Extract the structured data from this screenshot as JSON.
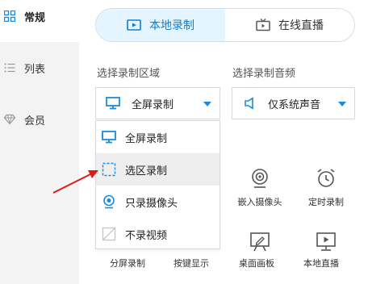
{
  "colors": {
    "accent": "#1a8be0",
    "tab_active_bg": "#e5f5ff",
    "arrow": "#e0191b"
  },
  "sidebar": {
    "items": [
      {
        "label": "常规",
        "icon": "grid-icon",
        "active": true
      },
      {
        "label": "列表",
        "icon": "list-icon",
        "active": false
      },
      {
        "label": "会员",
        "icon": "diamond-icon",
        "active": false
      }
    ]
  },
  "tabs": [
    {
      "label": "本地录制",
      "icon": "video-record-icon",
      "active": true
    },
    {
      "label": "在线直播",
      "icon": "tv-icon",
      "active": false
    }
  ],
  "record_area": {
    "label": "选择录制区域",
    "selected": "全屏录制",
    "options": [
      {
        "label": "全屏录制",
        "icon": "monitor-icon"
      },
      {
        "label": "选区录制",
        "icon": "selection-icon"
      },
      {
        "label": "只录摄像头",
        "icon": "webcam-icon"
      },
      {
        "label": "不录视频",
        "icon": "no-video-icon"
      }
    ]
  },
  "record_audio": {
    "label": "选择录制音频",
    "selected": "仅系统声音",
    "icon": "speaker-icon"
  },
  "features": [
    {
      "label": "嵌入摄像头",
      "icon": "webcam-icon"
    },
    {
      "label": "定时录制",
      "icon": "alarm-clock-icon"
    },
    {
      "label": "桌面画板",
      "icon": "drawing-board-icon"
    },
    {
      "label": "本地直播",
      "icon": "live-screen-icon"
    }
  ],
  "bottom_labels": {
    "split_screen": "分屏录制",
    "hotkey_display": "按键显示"
  }
}
